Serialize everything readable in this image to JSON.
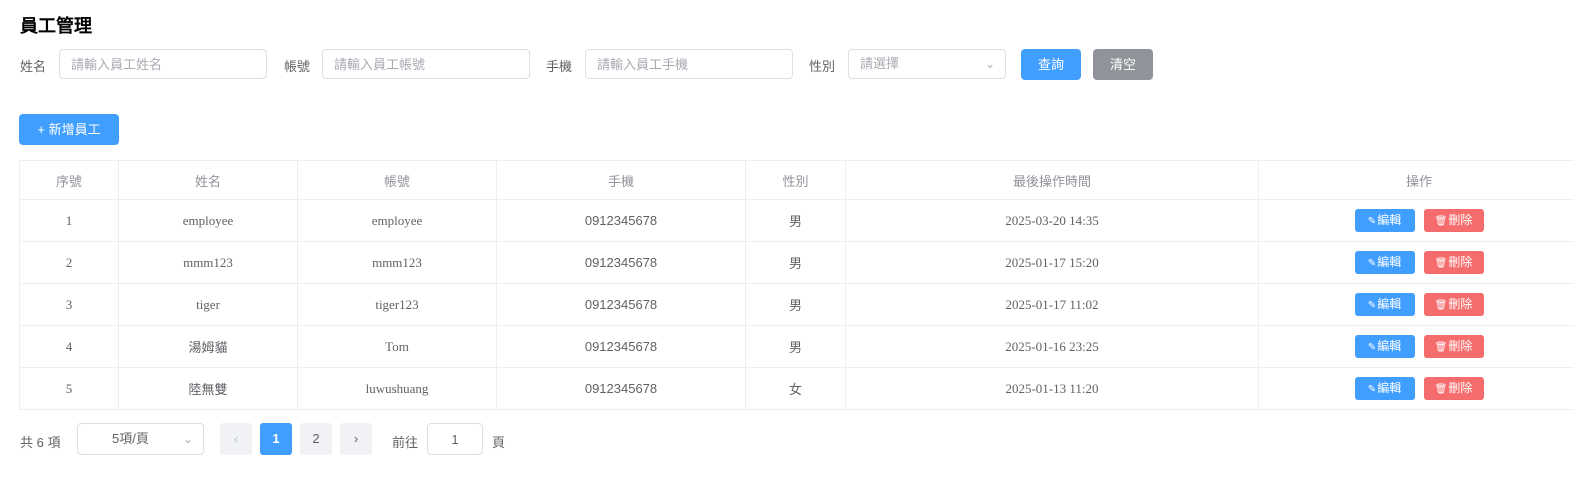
{
  "page": {
    "title": "員工管理"
  },
  "filters": {
    "name_label": "姓名",
    "name_placeholder": "請輸入員工姓名",
    "account_label": "帳號",
    "account_placeholder": "請輸入員工帳號",
    "phone_label": "手機",
    "phone_placeholder": "請輸入員工手機",
    "gender_label": "性別",
    "gender_placeholder": "請選擇",
    "search_label": "查詢",
    "clear_label": "清空"
  },
  "toolbar": {
    "add_label": "+ 新增員工"
  },
  "table": {
    "headers": [
      "序號",
      "姓名",
      "帳號",
      "手機",
      "性別",
      "最後操作時間",
      "操作"
    ],
    "edit_label": "編輯",
    "delete_label": "刪除",
    "rows": [
      [
        "1",
        "employee",
        "employee",
        "0912345678",
        "男",
        "2025-03-20 14:35"
      ],
      [
        "2",
        "mmm123",
        "mmm123",
        "0912345678",
        "男",
        "2025-01-17 15:20"
      ],
      [
        "3",
        "tiger",
        "tiger123",
        "0912345678",
        "男",
        "2025-01-17 11:02"
      ],
      [
        "4",
        "湯姆貓",
        "Tom",
        "0912345678",
        "男",
        "2025-01-16 23:25"
      ],
      [
        "5",
        "陸無雙",
        "luwushuang",
        "0912345678",
        "女",
        "2025-01-13 11:20"
      ]
    ]
  },
  "pagination": {
    "total_text": "共 6 項",
    "page_size": "5項/頁",
    "pages": [
      "1",
      "2"
    ],
    "current_page": 1,
    "goto_prefix": "前往",
    "goto_value": "1",
    "goto_suffix": "頁"
  },
  "colors": {
    "primary": "#409eff",
    "danger": "#f56c6c",
    "gray": "#909399"
  }
}
